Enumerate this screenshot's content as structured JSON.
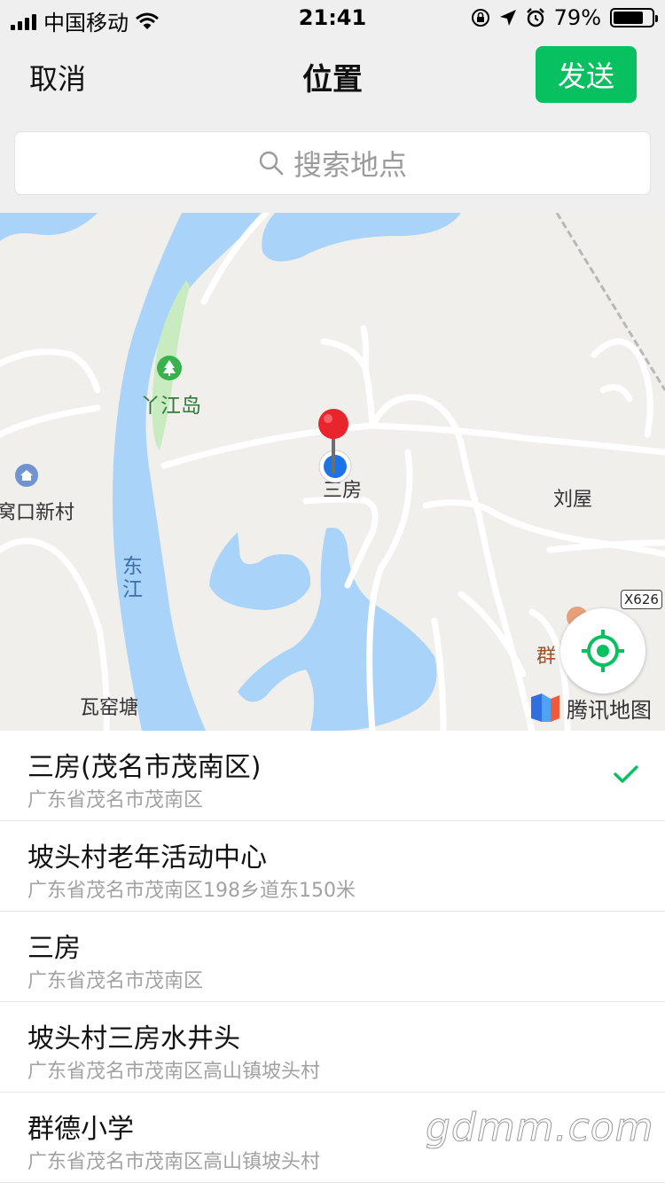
{
  "status_bar": {
    "carrier": "中国移动",
    "time": "21:41",
    "battery_percent_label": "79%",
    "battery_level": 0.79
  },
  "nav": {
    "cancel_label": "取消",
    "title": "位置",
    "send_label": "发送",
    "send_color": "#07c160"
  },
  "search": {
    "placeholder": "搜索地点"
  },
  "map": {
    "labels": {
      "island": "丫江岛",
      "village_left": "窝口新村",
      "river": "东江",
      "pin_place": "三房",
      "right_place": "刘屋",
      "bottom_left": "瓦窑塘",
      "partial_right": "群",
      "road_code": "X626"
    },
    "brand": "腾讯地图",
    "colors": {
      "water": "#a9d3f8",
      "land": "#f0efec",
      "park": "#c8ecc0",
      "road": "#ffffff"
    }
  },
  "results": [
    {
      "title": "三房(茂名市茂南区)",
      "subtitle": "广东省茂名市茂南区",
      "selected": true
    },
    {
      "title": "坡头村老年活动中心",
      "subtitle": "广东省茂名市茂南区198乡道东150米",
      "selected": false
    },
    {
      "title": "三房",
      "subtitle": "广东省茂名市茂南区",
      "selected": false
    },
    {
      "title": "坡头村三房水井头",
      "subtitle": "广东省茂名市茂南区高山镇坡头村",
      "selected": false
    },
    {
      "title": "群德小学",
      "subtitle": "广东省茂名市茂南区高山镇坡头村",
      "selected": false
    }
  ],
  "watermark": "gdmm.com"
}
